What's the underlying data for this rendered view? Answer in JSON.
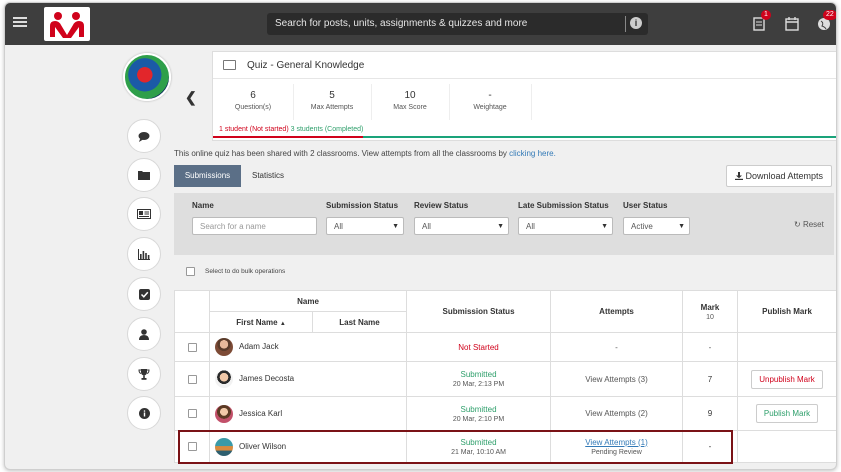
{
  "topbar": {
    "search_placeholder": "Search for posts, units, assignments & quizzes and more",
    "notifications_badge": "1",
    "messages_badge": "22"
  },
  "quiz": {
    "title": "Quiz - General Knowledge",
    "stats": [
      {
        "value": "6",
        "label": "Question(s)"
      },
      {
        "value": "5",
        "label": "Max Attempts"
      },
      {
        "value": "10",
        "label": "Max Score"
      },
      {
        "value": "-",
        "label": "Weightage"
      }
    ],
    "status_not_started": "1 student (Not started)",
    "status_completed": "3 students (Completed)",
    "progress": {
      "not_started": 1,
      "completed": 3
    }
  },
  "shared": {
    "text": "This online quiz has been shared with 2 classrooms. View attempts from all the classrooms by ",
    "link": "clicking here."
  },
  "tabs": {
    "submissions": "Submissions",
    "statistics": "Statistics"
  },
  "download_label": "Download Attempts",
  "filters": {
    "name_label": "Name",
    "name_placeholder": "Search for a name",
    "submission_status_label": "Submission Status",
    "submission_status_value": "All",
    "review_status_label": "Review Status",
    "review_status_value": "All",
    "late_submission_label": "Late Submission Status",
    "late_submission_value": "All",
    "user_status_label": "User Status",
    "user_status_value": "Active",
    "reset_label": "Reset"
  },
  "bulk_label": "Select to do bulk operations",
  "table": {
    "headers": {
      "name": "Name",
      "first_name": "First Name",
      "last_name": "Last Name",
      "submission_status": "Submission Status",
      "attempts": "Attempts",
      "mark": "Mark",
      "mark_max": "10",
      "publish_mark": "Publish Mark"
    },
    "rows": [
      {
        "name": "Adam Jack",
        "status": "Not Started",
        "status_date": "",
        "attempts": "-",
        "review": "",
        "mark": "-",
        "publish": ""
      },
      {
        "name": "James Decosta",
        "status": "Submitted",
        "status_date": "20 Mar, 2:13 PM",
        "attempts": "View Attempts (3)",
        "review": "",
        "mark": "7",
        "publish": "Unpublish Mark"
      },
      {
        "name": "Jessica Karl",
        "status": "Submitted",
        "status_date": "20 Mar, 2:10 PM",
        "attempts": "View Attempts (2)",
        "review": "",
        "mark": "9",
        "publish": "Publish Mark"
      },
      {
        "name": "Oliver Wilson",
        "status": "Submitted",
        "status_date": "21 Mar, 10:10 AM",
        "attempts": "View Attempts (1)",
        "review": "Pending Review",
        "mark": "-",
        "publish": ""
      }
    ]
  },
  "colors": {
    "brand_red": "#d0021b",
    "success_green": "#2e9f6b",
    "tab_active": "#5b6f87",
    "highlight": "#7a1216"
  }
}
